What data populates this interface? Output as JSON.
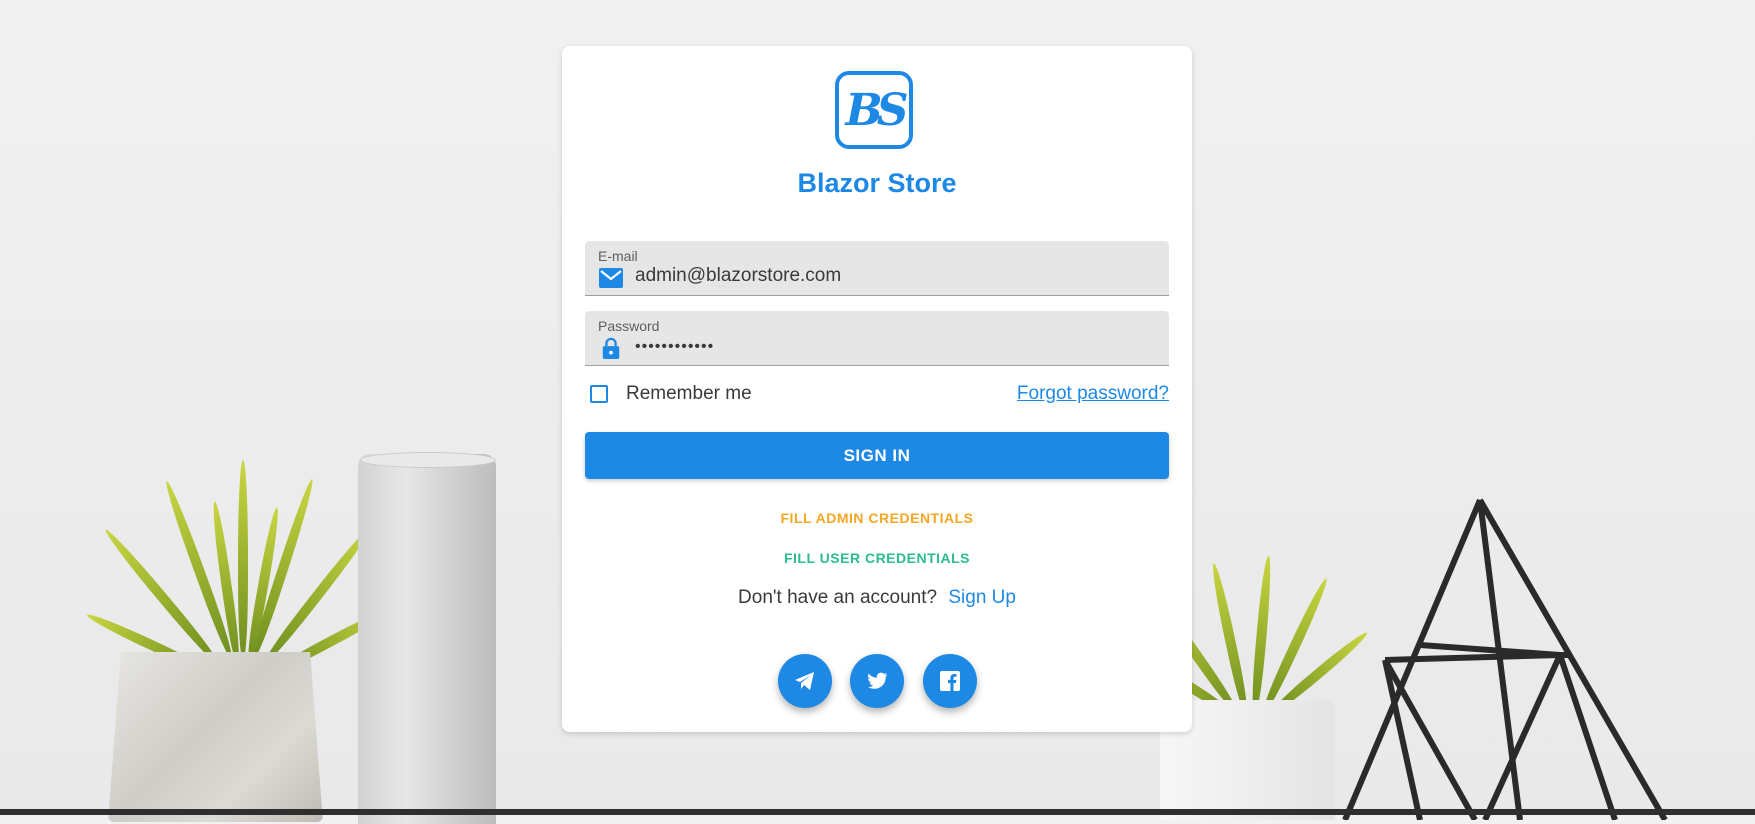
{
  "brand": {
    "name": "Blazor Store",
    "logo_text": "BS"
  },
  "form": {
    "email_label": "E-mail",
    "email_value": "admin@blazorstore.com",
    "password_label": "Password",
    "password_value": "••••••••••••",
    "remember_label": "Remember me",
    "forgot_label": "Forgot password?",
    "signin_label": "SIGN IN",
    "fill_admin_label": "FILL ADMIN CREDENTIALS",
    "fill_user_label": "FILL USER CREDENTIALS",
    "no_account_text": "Don't have an account?",
    "signup_label": "Sign Up"
  },
  "colors": {
    "primary": "#1e88e5",
    "admin": "#f5a623",
    "user": "#2bbd8c"
  },
  "icons": {
    "email": "email-icon",
    "password": "lock-icon",
    "social": [
      "telegram-icon",
      "twitter-icon",
      "facebook-icon"
    ]
  }
}
